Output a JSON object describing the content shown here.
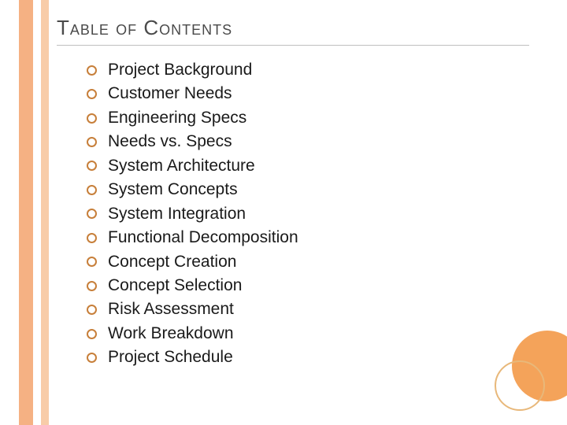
{
  "title": "Table of Contents",
  "toc": {
    "items": [
      {
        "label": "Project Background"
      },
      {
        "label": "Customer Needs"
      },
      {
        "label": "Engineering Specs"
      },
      {
        "label": "Needs vs. Specs"
      },
      {
        "label": "System Architecture"
      },
      {
        "label": "System Concepts"
      },
      {
        "label": "System Integration"
      },
      {
        "label": "Functional Decomposition"
      },
      {
        "label": "Concept Creation"
      },
      {
        "label": "Concept Selection"
      },
      {
        "label": "Risk Assessment"
      },
      {
        "label": "Work Breakdown"
      },
      {
        "label": "Project Schedule"
      }
    ]
  }
}
